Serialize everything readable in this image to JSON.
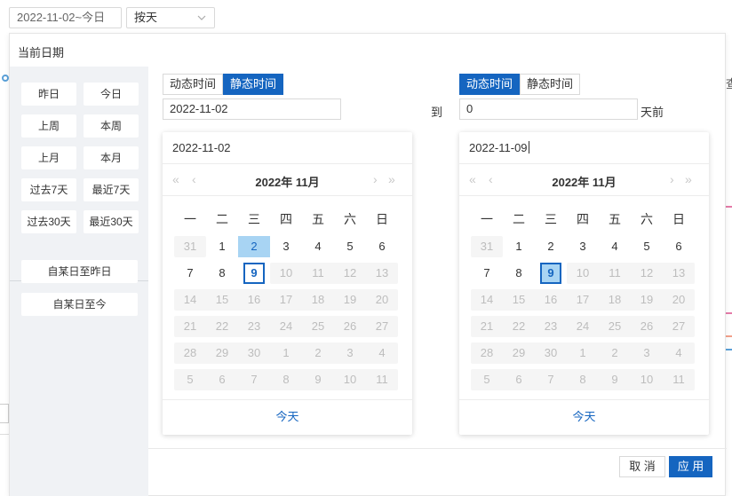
{
  "toolbar": {
    "range_value": "2022-11-02~今日",
    "mode_value": "按天"
  },
  "background": {
    "right_char": "查"
  },
  "popup": {
    "title": "当前日期",
    "quick_ranges": [
      "昨日",
      "今日",
      "上周",
      "本周",
      "上月",
      "本月",
      "过去7天",
      "最近7天",
      "过去30天",
      "最近30天"
    ],
    "custom_ranges": [
      "自某日至昨日",
      "自某日至今"
    ],
    "start": {
      "tabs": [
        "动态时间",
        "静态时间"
      ],
      "active_tab": "静态时间",
      "value": "2022-11-02",
      "calendar": {
        "input": "2022-11-02",
        "title": "2022年 11月",
        "weekdays": [
          "一",
          "二",
          "三",
          "四",
          "五",
          "六",
          "日"
        ],
        "days": [
          [
            "31",
            "1",
            "2",
            "3",
            "4",
            "5",
            "6"
          ],
          [
            "7",
            "8",
            "9",
            "10",
            "11",
            "12",
            "13"
          ],
          [
            "14",
            "15",
            "16",
            "17",
            "18",
            "19",
            "20"
          ],
          [
            "21",
            "22",
            "23",
            "24",
            "25",
            "26",
            "27"
          ],
          [
            "28",
            "29",
            "30",
            "1",
            "2",
            "3",
            "4"
          ],
          [
            "5",
            "6",
            "7",
            "8",
            "9",
            "10",
            "11"
          ]
        ],
        "selected": "2",
        "today": "9",
        "footer": "今天"
      }
    },
    "to_label": "到",
    "end": {
      "tabs": [
        "动态时间",
        "静态时间"
      ],
      "active_tab": "动态时间",
      "value": "0",
      "suffix": "天前",
      "calendar": {
        "input": "2022-11-09",
        "title": "2022年 11月",
        "weekdays": [
          "一",
          "二",
          "三",
          "四",
          "五",
          "六",
          "日"
        ],
        "days": [
          [
            "31",
            "1",
            "2",
            "3",
            "4",
            "5",
            "6"
          ],
          [
            "7",
            "8",
            "9",
            "10",
            "11",
            "12",
            "13"
          ],
          [
            "14",
            "15",
            "16",
            "17",
            "18",
            "19",
            "20"
          ],
          [
            "21",
            "22",
            "23",
            "24",
            "25",
            "26",
            "27"
          ],
          [
            "28",
            "29",
            "30",
            "1",
            "2",
            "3",
            "4"
          ],
          [
            "5",
            "6",
            "7",
            "8",
            "9",
            "10",
            "11"
          ]
        ],
        "selected": "9",
        "today": "9",
        "footer": "今天"
      }
    },
    "cancel_label": "取 消",
    "apply_label": "应 用"
  },
  "colors": {
    "accent": "#1565c0",
    "selected_day": "#a8d4f3",
    "disabled_day": "#f5f5f5",
    "sidebar_bg": "#f0f2f5"
  }
}
